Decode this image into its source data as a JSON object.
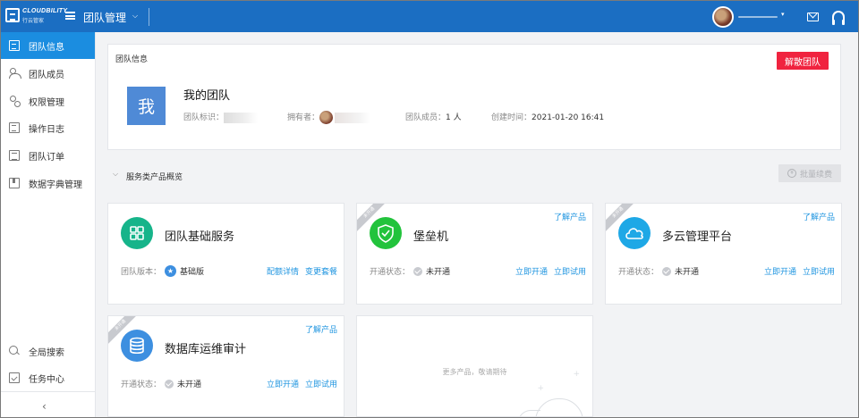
{
  "brand": {
    "logo_text": "CLOUDBILITY",
    "logo_sub": "行云管家"
  },
  "topbar": {
    "title": "团队管理"
  },
  "sidebar": {
    "items": [
      {
        "label": "团队信息"
      },
      {
        "label": "团队成员"
      },
      {
        "label": "权限管理"
      },
      {
        "label": "操作日志"
      },
      {
        "label": "团队订单"
      },
      {
        "label": "数据字典管理"
      }
    ],
    "bottom_items": [
      {
        "label": "全局搜索"
      },
      {
        "label": "任务中心"
      }
    ],
    "collapse_glyph": "‹"
  },
  "team_info": {
    "section_title": "团队信息",
    "dissolve_label": "解散团队",
    "avatar_char": "我",
    "name": "我的团队",
    "id_label": "团队标识：",
    "owner_label": "拥有者：",
    "members_label": "团队成员：",
    "members_value": "1 人",
    "created_label": "创建时间：",
    "created_value": "2021-01-20 16:41"
  },
  "overview": {
    "title": "服务类产品概览",
    "renew_label": "批量续费",
    "renew_icon": "¥"
  },
  "cards": [
    {
      "name": "团队基础服务",
      "status_label": "团队版本：",
      "status_value": "基础版",
      "actions": [
        "配额详情",
        "变更套餐"
      ]
    },
    {
      "name": "堡垒机",
      "ribbon": "未开通",
      "learn": "了解产品",
      "status_label": "开通状态：",
      "status_value": "未开通",
      "actions": [
        "立即开通",
        "立即试用"
      ]
    },
    {
      "name": "多云管理平台",
      "ribbon": "未开通",
      "learn": "了解产品",
      "status_label": "开通状态：",
      "status_value": "未开通",
      "actions": [
        "立即开通",
        "立即试用"
      ]
    },
    {
      "name": "数据库运维审计",
      "ribbon": "未开通",
      "learn": "了解产品",
      "status_label": "开通状态：",
      "status_value": "未开通",
      "actions": [
        "立即开通",
        "立即试用"
      ]
    }
  ],
  "more_products": {
    "text": "更多产品，敬请期待"
  },
  "colors": {
    "primary": "#1b6ec2",
    "active_sidebar": "#1b8de0",
    "danger": "#f0233f",
    "link": "#2196e0",
    "team_base_icon": "#16b48a",
    "bastion_icon": "#22c33c",
    "multicloud_icon": "#1ea8e6",
    "db_audit_icon": "#3d8fe0"
  }
}
